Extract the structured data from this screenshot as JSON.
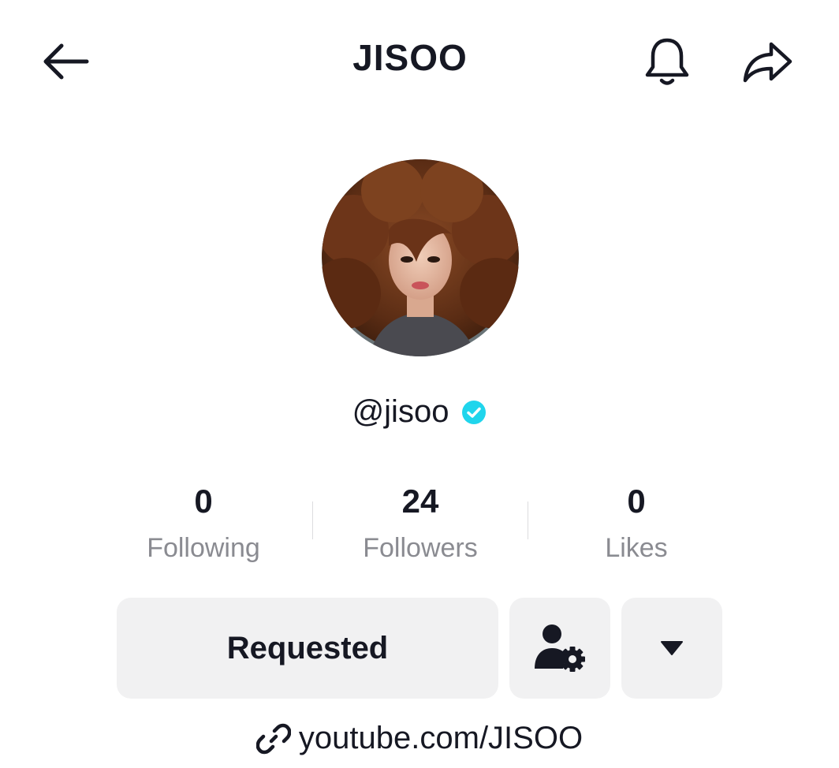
{
  "header": {
    "title": "JISOO",
    "back_icon": "arrow-left-icon",
    "bell_icon": "bell-icon",
    "share_icon": "share-icon"
  },
  "profile": {
    "username": "@jisoo",
    "verified": true,
    "verified_color": "#20d5ec"
  },
  "stats": [
    {
      "value": "0",
      "label": "Following"
    },
    {
      "value": "24",
      "label": "Followers"
    },
    {
      "value": "0",
      "label": "Likes"
    }
  ],
  "actions": {
    "requested_label": "Requested",
    "friend_settings_icon": "user-settings-icon",
    "more_icon": "caret-down-icon"
  },
  "bio": {
    "link": "youtube.com/JISOO",
    "link_icon": "link-icon"
  },
  "colors": {
    "text_primary": "#161823",
    "text_secondary": "#8a8b91",
    "button_bg": "#f1f1f2"
  }
}
